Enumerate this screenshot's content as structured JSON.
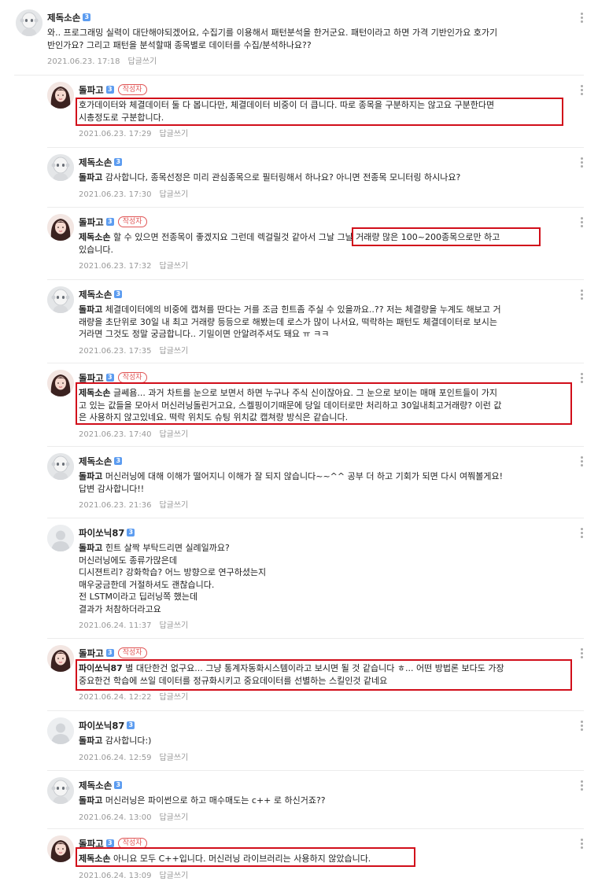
{
  "comments": [
    {
      "author": "제독소손",
      "is_writer": false,
      "avatar": "robot",
      "text_lines": [
        "와.. 프로그래밍 실력이 대단해야되겠어요, 수집기를 이용해서 패턴분석을 한거군요. 패턴이라고 하면 가격 기반인가요 호가기",
        "반인가요? 그리고 패턴을 분석할때 종목별로 데이터를 수집/분석하나요??"
      ],
      "date": "2021.06.23. 17:18",
      "reply_label": "답글쓰기"
    },
    {
      "author": "돌파고",
      "is_writer": true,
      "avatar": "woman",
      "text_lines": [
        "호가데이터와 체결데이터 둘 다 봅니다만, 체결데이터 비중이 더 큽니다. 따로 종목을 구분하지는 않고요 구분한다면",
        "시총정도로 구분합니다."
      ],
      "date": "2021.06.23. 17:29",
      "reply_label": "답글쓰기"
    },
    {
      "author": "제독소손",
      "is_writer": false,
      "avatar": "robot",
      "mention": "돌파고",
      "text_lines": [
        " 감사합니다, 종목선정은 미리 관심종목으로 필터링해서 하나요? 아니면 전종목 모니터링 하시나요?"
      ],
      "date": "2021.06.23. 17:30",
      "reply_label": "답글쓰기"
    },
    {
      "author": "돌파고",
      "is_writer": true,
      "avatar": "woman",
      "mention": "제독소손",
      "text_lines": [
        " 할 수 있으면 전종목이 좋겠지요 그런데 렉걸릴것 같아서 그날 그날 거래량 많은 100~200종목으로만 하고",
        "있습니다."
      ],
      "date": "2021.06.23. 17:32",
      "reply_label": "답글쓰기"
    },
    {
      "author": "제독소손",
      "is_writer": false,
      "avatar": "robot",
      "mention": "돌파고",
      "text_lines": [
        " 체결데이터에의 비중에 캡쳐를 딴다는 거를 조금 힌트좀 주실 수 있을까요..?? 저는 체결량을 누계도 해보고 거",
        "래량을 초단위로 30일 내 최고 거래량 등등으로 해봤는데 로스가 많이 나서요, 떡락하는 패턴도 체결데이터로 보시는",
        "거라면 그것도 정말 궁금합니다.. 기밀이면 안알려주셔도 돼요 ㅠ ㅋㅋ"
      ],
      "date": "2021.06.23. 17:35",
      "reply_label": "답글쓰기"
    },
    {
      "author": "돌파고",
      "is_writer": true,
      "avatar": "woman",
      "mention": "제독소손",
      "text_lines": [
        " 글쎄욤... 과거 차트를 눈으로 보면서 하면 누구나 주식 신이잖아요. 그 눈으로 보이는 매매 포인트들이 가지",
        "고 있는 값들을 모아서 머신러닝돌린거고요, 스켈핑이기때문에 당일 데이터로만 처리하고 30일내최고거래량? 이런 값",
        "은 사용하지 않고있네요. 떡락 위치도 슈팅 위치값 캡쳐랑 방식은 같습니다."
      ],
      "date": "2021.06.23. 17:40",
      "reply_label": "답글쓰기"
    },
    {
      "author": "제독소손",
      "is_writer": false,
      "avatar": "robot",
      "mention": "돌파고",
      "text_lines": [
        " 머신러닝에 대해 이해가 떨어지니 이해가 잘 되지 않습니다~~^^ 공부 더 하고 기회가 되면 다시 여쭤볼게요!",
        "답변 감사합니다!!"
      ],
      "date": "2021.06.23. 21:36",
      "reply_label": "답글쓰기"
    },
    {
      "author": "파이쏘닉87",
      "is_writer": false,
      "avatar": "default",
      "mention": "돌파고",
      "text_lines": [
        " 힌트 살짝 부탁드리면 실례일까요?",
        "머신러닝에도 종류가많은데",
        "디시젼트리? 강화학습? 어느 방향으로 연구하셨는지",
        "매우궁금한데 거절하셔도 괜찮습니다.",
        "전 LSTM이라고 딥러닝쪽 했는데",
        "결과가 처참하더라고요"
      ],
      "date": "2021.06.24. 11:37",
      "reply_label": "답글쓰기"
    },
    {
      "author": "돌파고",
      "is_writer": true,
      "avatar": "woman",
      "mention": "파이쏘닉87",
      "text_lines": [
        " 별 대단한건 없구요... 그냥 통계자동화시스템이라고 보시면 될 것 같습니다 ㅎ... 어떤 방법론 보다도 가장",
        "중요한건 학습에 쓰일 데이터를 정규화시키고 중요데이터를 선별하는 스킬인것 같네요"
      ],
      "date": "2021.06.24. 12:22",
      "reply_label": "답글쓰기"
    },
    {
      "author": "파이쏘닉87",
      "is_writer": false,
      "avatar": "default",
      "mention": "돌파고",
      "text_lines": [
        " 감사합니다:)"
      ],
      "date": "2021.06.24. 12:59",
      "reply_label": "답글쓰기"
    },
    {
      "author": "제독소손",
      "is_writer": false,
      "avatar": "robot",
      "mention": "돌파고",
      "text_lines": [
        " 머신러닝은 파이썬으로 하고 매수매도는 c++ 로 하신거죠??"
      ],
      "date": "2021.06.24. 13:00",
      "reply_label": "답글쓰기"
    },
    {
      "author": "돌파고",
      "is_writer": true,
      "avatar": "woman",
      "mention": "제독소손",
      "text_lines": [
        " 아니요 모두 C++입니다. 머신러닝 라이브러리는 사용하지 않았습니다."
      ],
      "date": "2021.06.24. 13:09",
      "reply_label": "답글쓰기"
    }
  ],
  "writer_tag_label": "작성자",
  "colors": {
    "highlight": "#d10e1a",
    "badge": "#5c9cf0",
    "writer_tag": "#e05656"
  }
}
